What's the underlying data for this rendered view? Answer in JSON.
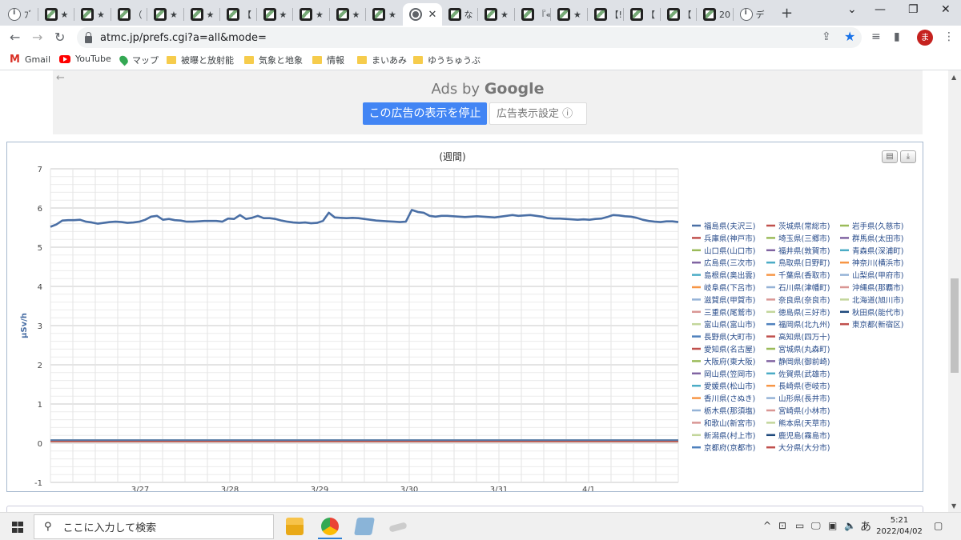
{
  "browser": {
    "tabs": [
      {
        "icon": "info-icon",
        "title": "ﾌﾞ"
      },
      {
        "icon": "site-favicon",
        "title": "★"
      },
      {
        "icon": "site-favicon",
        "title": "★"
      },
      {
        "icon": "site-favicon",
        "title": "（"
      },
      {
        "icon": "site-favicon",
        "title": "★"
      },
      {
        "icon": "site-favicon",
        "title": "★"
      },
      {
        "icon": "site-favicon",
        "title": "【"
      },
      {
        "icon": "site-favicon",
        "title": "★"
      },
      {
        "icon": "site-favicon",
        "title": "★"
      },
      {
        "icon": "site-favicon",
        "title": "★"
      },
      {
        "icon": "site-favicon",
        "title": "★"
      },
      {
        "icon": "globe-icon",
        "title": "",
        "active": true,
        "close": "✕"
      },
      {
        "icon": "site-favicon",
        "title": "な"
      },
      {
        "icon": "site-favicon",
        "title": "★"
      },
      {
        "icon": "site-favicon",
        "title": "『«"
      },
      {
        "icon": "site-favicon",
        "title": "★"
      },
      {
        "icon": "site-favicon",
        "title": "【!"
      },
      {
        "icon": "site-favicon",
        "title": "【"
      },
      {
        "icon": "site-favicon",
        "title": "【"
      },
      {
        "icon": "site-favicon",
        "title": "20"
      },
      {
        "icon": "info-icon",
        "title": "デ"
      }
    ],
    "new_tab": "+",
    "url": "atmc.jp/prefs.cgi?a=all&mode=",
    "avatar_initial": "ま",
    "bookmarks": [
      {
        "icon": "gmail-icon",
        "label": "Gmail"
      },
      {
        "icon": "youtube-icon",
        "label": "YouTube"
      },
      {
        "icon": "maps-icon",
        "label": "マップ"
      },
      {
        "icon": "folder-icon",
        "label": "被曝と放射能"
      },
      {
        "icon": "folder-icon",
        "label": "気象と地象"
      },
      {
        "icon": "folder-icon",
        "label": "情報"
      },
      {
        "icon": "folder-icon",
        "label": "まいあみ"
      },
      {
        "icon": "folder-icon",
        "label": "ゆうちゅうぶ"
      }
    ]
  },
  "ad": {
    "ads_by": "Ads by",
    "google": "Google",
    "stop_label": "この広告の表示を停止",
    "settings_label": "広告表示設定 ⓘ"
  },
  "chart_data": {
    "type": "line",
    "title": "(週間)",
    "ylabel": "μSv/h",
    "xlabel": "",
    "ylim": [
      -1,
      7
    ],
    "yticks": [
      -1,
      0,
      1,
      2,
      3,
      4,
      5,
      6,
      7
    ],
    "x_ticks": [
      "3/27",
      "3/28",
      "3/29",
      "3/30",
      "3/31",
      "4/1"
    ],
    "grid": true,
    "legend_placement": "right",
    "series_main": {
      "name": "福島県(夫沢三)",
      "color": "#4a6fa5",
      "x_range": [
        "3/26",
        "4/1"
      ],
      "values": [
        5.52,
        5.58,
        5.68,
        5.69,
        5.69,
        5.7,
        5.65,
        5.63,
        5.6,
        5.62,
        5.64,
        5.65,
        5.64,
        5.62,
        5.63,
        5.65,
        5.7,
        5.78,
        5.8,
        5.7,
        5.72,
        5.69,
        5.68,
        5.65,
        5.65,
        5.66,
        5.67,
        5.67,
        5.67,
        5.65,
        5.73,
        5.72,
        5.82,
        5.72,
        5.75,
        5.8,
        5.74,
        5.74,
        5.72,
        5.68,
        5.65,
        5.63,
        5.62,
        5.63,
        5.61,
        5.62,
        5.67,
        5.88,
        5.76,
        5.75,
        5.74,
        5.75,
        5.74,
        5.72,
        5.7,
        5.68,
        5.67,
        5.66,
        5.65,
        5.64,
        5.65,
        5.95,
        5.9,
        5.88,
        5.8,
        5.78,
        5.8,
        5.8,
        5.79,
        5.78,
        5.77,
        5.78,
        5.79,
        5.78,
        5.77,
        5.76,
        5.78,
        5.8,
        5.82,
        5.8,
        5.81,
        5.82,
        5.8,
        5.78,
        5.74,
        5.73,
        5.73,
        5.72,
        5.71,
        5.7,
        5.71,
        5.7,
        5.72,
        5.73,
        5.77,
        5.82,
        5.81,
        5.79,
        5.78,
        5.75,
        5.7,
        5.67,
        5.65,
        5.64,
        5.66,
        5.66,
        5.64
      ]
    },
    "others_baseline": 0.06,
    "legend": [
      [
        {
          "name": "福島県(夫沢三)",
          "color": "#4a6fa5"
        },
        {
          "name": "茨城県(常総市)",
          "color": "#c0504d"
        },
        {
          "name": "岩手県(久慈市)",
          "color": "#9bbb59"
        }
      ],
      [
        {
          "name": "兵庫県(神戸市)",
          "color": "#c0504d"
        },
        {
          "name": "埼玉県(三郷市)",
          "color": "#9bbb59"
        },
        {
          "name": "群馬県(太田市)",
          "color": "#8064a2"
        }
      ],
      [
        {
          "name": "山口県(山口市)",
          "color": "#9bbb59"
        },
        {
          "name": "福井県(敦賀市)",
          "color": "#8064a2"
        },
        {
          "name": "青森県(深浦町)",
          "color": "#4bacc6"
        }
      ],
      [
        {
          "name": "広島県(三次市)",
          "color": "#8064a2"
        },
        {
          "name": "鳥取県(日野町)",
          "color": "#4bacc6"
        },
        {
          "name": "神奈川(横浜市)",
          "color": "#f79646"
        }
      ],
      [
        {
          "name": "島根県(奥出雲)",
          "color": "#4bacc6"
        },
        {
          "name": "千葉県(香取市)",
          "color": "#f79646"
        },
        {
          "name": "山梨県(甲府市)",
          "color": "#95b3d7"
        }
      ],
      [
        {
          "name": "岐阜県(下呂市)",
          "color": "#f79646"
        },
        {
          "name": "石川県(津幡町)",
          "color": "#95b3d7"
        },
        {
          "name": "沖縄県(那覇市)",
          "color": "#d99694"
        }
      ],
      [
        {
          "name": "滋賀県(甲賀市)",
          "color": "#95b3d7"
        },
        {
          "name": "奈良県(奈良市)",
          "color": "#d99694"
        },
        {
          "name": "北海道(旭川市)",
          "color": "#c3d69b"
        }
      ],
      [
        {
          "name": "三重県(尾鷲市)",
          "color": "#d99694"
        },
        {
          "name": "徳島県(三好市)",
          "color": "#c3d69b"
        },
        {
          "name": "秋田県(能代市)",
          "color": "#1f497d"
        }
      ],
      [
        {
          "name": "富山県(富山市)",
          "color": "#c3d69b"
        },
        {
          "name": "福岡県(北九州)",
          "color": "#4f81bd"
        },
        {
          "name": "東京都(新宿区)",
          "color": "#c0504d"
        }
      ],
      [
        {
          "name": "長野県(大町市)",
          "color": "#4f81bd"
        },
        {
          "name": "高知県(四万十)",
          "color": "#c0504d"
        }
      ],
      [
        {
          "name": "愛知県(名古屋)",
          "color": "#c0504d"
        },
        {
          "name": "宮城県(丸森町)",
          "color": "#9bbb59"
        }
      ],
      [
        {
          "name": "大阪府(東大阪)",
          "color": "#9bbb59"
        },
        {
          "name": "静岡県(御前崎)",
          "color": "#8064a2"
        }
      ],
      [
        {
          "name": "岡山県(笠岡市)",
          "color": "#8064a2"
        },
        {
          "name": "佐賀県(武雄市)",
          "color": "#4bacc6"
        }
      ],
      [
        {
          "name": "愛媛県(松山市)",
          "color": "#4bacc6"
        },
        {
          "name": "長崎県(壱岐市)",
          "color": "#f79646"
        }
      ],
      [
        {
          "name": "香川県(さぬき)",
          "color": "#f79646"
        },
        {
          "name": "山形県(長井市)",
          "color": "#95b3d7"
        }
      ],
      [
        {
          "name": "栃木県(那須塩)",
          "color": "#95b3d7"
        },
        {
          "name": "宮崎県(小林市)",
          "color": "#d99694"
        }
      ],
      [
        {
          "name": "和歌山(新宮市)",
          "color": "#d99694"
        },
        {
          "name": "熊本県(天草市)",
          "color": "#c3d69b"
        }
      ],
      [
        {
          "name": "新潟県(村上市)",
          "color": "#c3d69b"
        },
        {
          "name": "鹿児島(霧島市)",
          "color": "#1f497d"
        }
      ],
      [
        {
          "name": "京都府(京都市)",
          "color": "#4f81bd"
        },
        {
          "name": "大分県(大分市)",
          "color": "#c0504d"
        }
      ]
    ]
  },
  "chart_buttons": {
    "print": "print-icon",
    "download": "download-icon"
  },
  "taskbar": {
    "search_placeholder": "ここに入力して検索",
    "ime": "あ",
    "time": "5:21",
    "date": "2022/04/02"
  }
}
